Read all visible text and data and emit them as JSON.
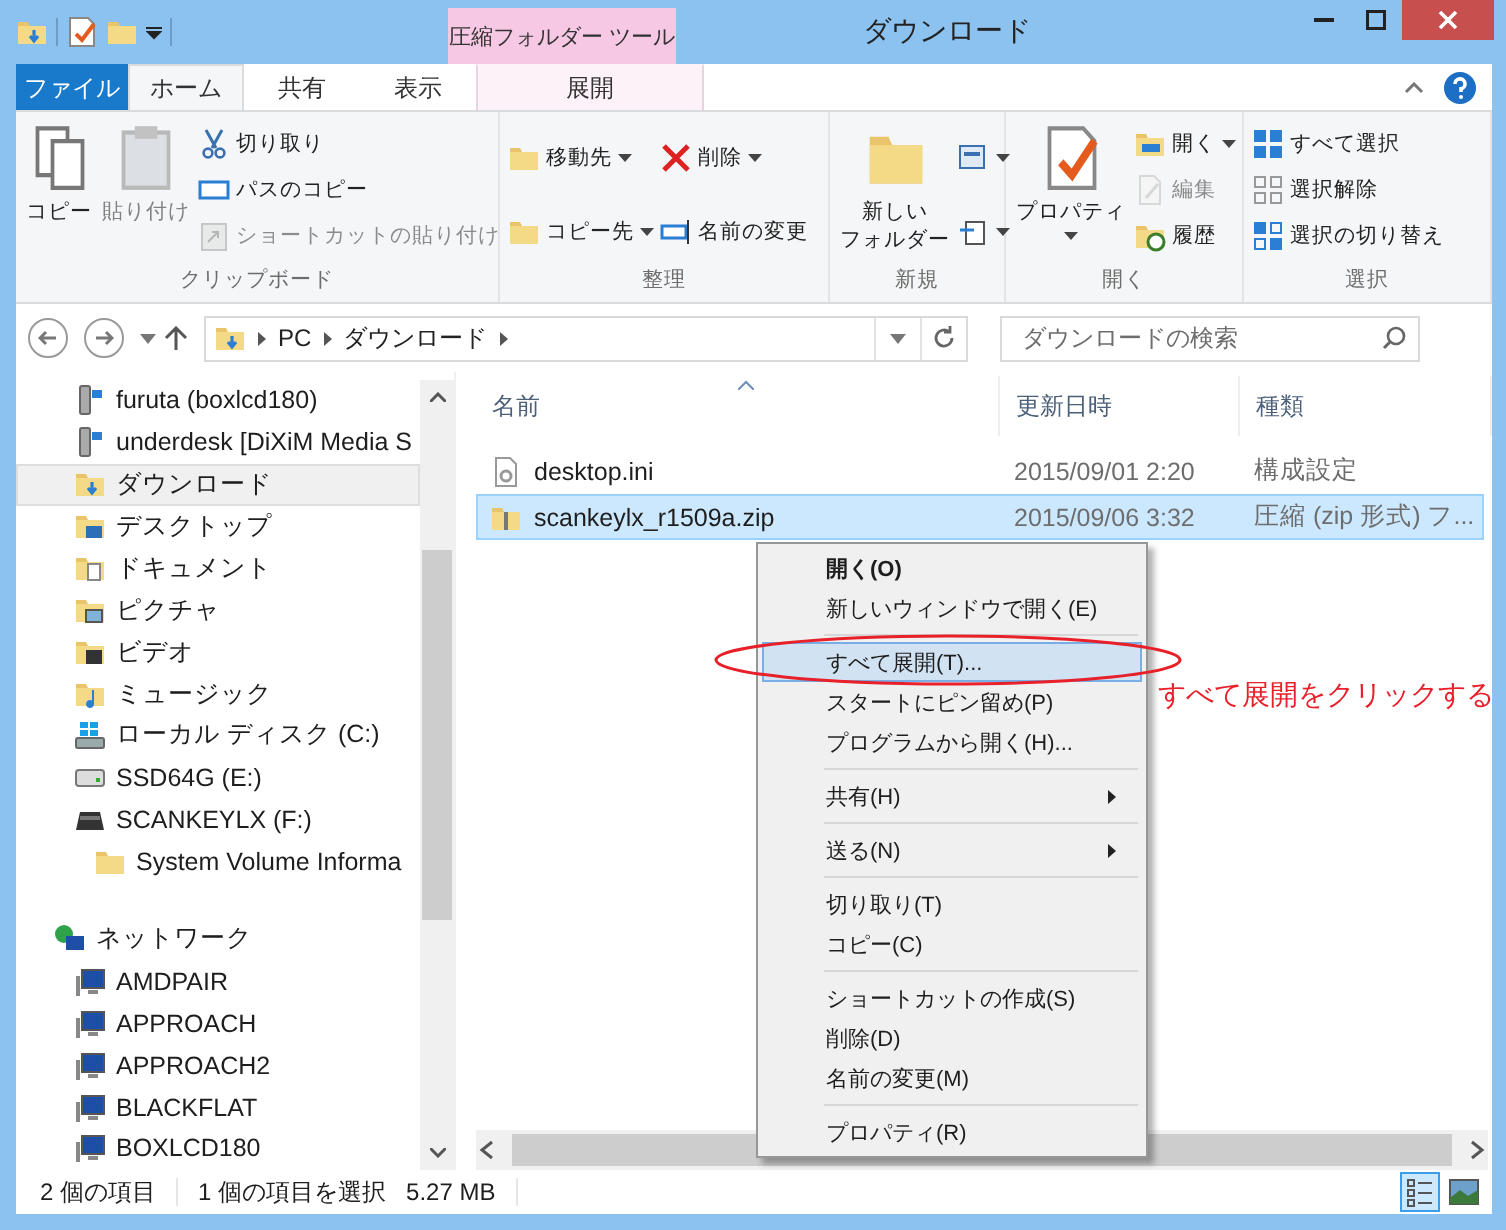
{
  "window": {
    "title": "ダウンロード"
  },
  "contextual_group": {
    "label": "圧縮フォルダー ツール"
  },
  "tabs": [
    {
      "label": "ファイル",
      "kind": "file",
      "selected": false
    },
    {
      "label": "ホーム",
      "kind": "normal",
      "selected": true
    },
    {
      "label": "共有",
      "kind": "normal",
      "selected": false
    },
    {
      "label": "表示",
      "kind": "normal",
      "selected": false
    },
    {
      "label": "展開",
      "kind": "contextual",
      "selected": false
    }
  ],
  "ribbon": [
    {
      "label": "クリップボード",
      "large": [
        {
          "lines": [
            "コピー"
          ],
          "kind": "copy",
          "disabled": false,
          "dropdown": false
        },
        {
          "lines": [
            "貼り付け"
          ],
          "kind": "paste",
          "disabled": true,
          "dropdown": false
        }
      ],
      "small_columns": [
        [
          {
            "label": "切り取り",
            "kind": "scissors",
            "disabled": false,
            "dropdown": false
          },
          {
            "label": "パスのコピー",
            "kind": "path",
            "disabled": false,
            "dropdown": false
          },
          {
            "label": "ショートカットの貼り付け",
            "kind": "shortcut",
            "disabled": true,
            "dropdown": false
          }
        ]
      ]
    },
    {
      "label": "整理",
      "small_columns": [
        [
          {
            "label": "移動先",
            "kind": "move",
            "disabled": false,
            "dropdown": true
          },
          {
            "label": "コピー先",
            "kind": "copyto",
            "disabled": false,
            "dropdown": true
          }
        ],
        [
          {
            "label": "削除",
            "kind": "delete",
            "disabled": false,
            "dropdown": true
          },
          {
            "label": "名前の変更",
            "kind": "rename",
            "disabled": false,
            "dropdown": false
          }
        ]
      ]
    },
    {
      "label": "新規",
      "large": [
        {
          "lines": [
            "新しい",
            "フォルダー"
          ],
          "kind": "folder",
          "disabled": false,
          "dropdown": false
        }
      ],
      "small_columns": [
        [
          {
            "kind": "newitem",
            "disabled": false,
            "dropdown": true
          },
          {
            "kind": "easyaccess",
            "disabled": false,
            "dropdown": true
          }
        ]
      ]
    },
    {
      "label": "開く",
      "large": [
        {
          "lines": [
            "プロパティ"
          ],
          "kind": "properties",
          "disabled": false,
          "dropdown": true
        }
      ],
      "small_columns": [
        [
          {
            "label": "開く",
            "kind": "open",
            "disabled": false,
            "dropdown": true
          },
          {
            "label": "編集",
            "kind": "edit",
            "disabled": true,
            "dropdown": false
          },
          {
            "label": "履歴",
            "kind": "history",
            "disabled": false,
            "dropdown": false
          }
        ]
      ]
    },
    {
      "label": "選択",
      "small_columns": [
        [
          {
            "label": "すべて選択",
            "kind": "selectall",
            "disabled": false,
            "dropdown": false
          },
          {
            "label": "選択解除",
            "kind": "selectnone",
            "disabled": false,
            "dropdown": false
          },
          {
            "label": "選択の切り替え",
            "kind": "invert",
            "disabled": false,
            "dropdown": false
          }
        ]
      ]
    }
  ],
  "address": {
    "path": [
      "PC",
      "ダウンロード"
    ]
  },
  "search": {
    "placeholder": "ダウンロードの検索"
  },
  "nav": {
    "items": [
      {
        "label": "furuta (boxlcd180)",
        "kind": "share",
        "selected": false
      },
      {
        "label": "underdesk [DiXiM Media S",
        "kind": "share",
        "selected": false
      },
      {
        "label": "ダウンロード",
        "kind": "downloads",
        "selected": true
      },
      {
        "label": "デスクトップ",
        "kind": "desktop",
        "selected": false
      },
      {
        "label": "ドキュメント",
        "kind": "documents",
        "selected": false
      },
      {
        "label": "ピクチャ",
        "kind": "pictures",
        "selected": false
      },
      {
        "label": "ビデオ",
        "kind": "videos",
        "selected": false
      },
      {
        "label": "ミュージック",
        "kind": "music",
        "selected": false
      },
      {
        "label": "ローカル ディスク (C:)",
        "kind": "system-drive",
        "selected": false
      },
      {
        "label": "SSD64G (E:)",
        "kind": "drive",
        "selected": false
      },
      {
        "label": "SCANKEYLX (F:)",
        "kind": "removable",
        "selected": false,
        "children": [
          {
            "label": "System Volume Informa",
            "kind": "folder",
            "selected": false
          }
        ]
      }
    ],
    "network": {
      "label": "ネットワーク",
      "children": [
        {
          "label": "AMDPAIR",
          "kind": "computer",
          "selected": false
        },
        {
          "label": "APPROACH",
          "kind": "computer",
          "selected": false
        },
        {
          "label": "APPROACH2",
          "kind": "computer",
          "selected": false
        },
        {
          "label": "BLACKFLAT",
          "kind": "computer",
          "selected": false
        },
        {
          "label": "BOXLCD180",
          "kind": "computer",
          "selected": false
        }
      ]
    }
  },
  "files": {
    "columns": [
      {
        "label": "名前",
        "sorted": true
      },
      {
        "label": "更新日時",
        "sorted": false
      },
      {
        "label": "種類",
        "sorted": false
      }
    ],
    "rows": [
      {
        "name": "desktop.ini",
        "date": "2015/09/01 2:20",
        "type": "構成設定",
        "kind": "settings",
        "selected": false
      },
      {
        "name": "scankeylx_r1509a.zip",
        "date": "2015/09/06 3:32",
        "type": "圧縮 (zip 形式) フ...",
        "kind": "zip",
        "selected": true
      }
    ]
  },
  "context_menu": [
    {
      "kind": "item",
      "label": "開く(O)",
      "default": true,
      "highlighted": false,
      "submenu": false
    },
    {
      "kind": "item",
      "label": "新しいウィンドウで開く(E)",
      "default": false,
      "highlighted": false,
      "submenu": false
    },
    {
      "kind": "separator"
    },
    {
      "kind": "item",
      "label": "すべて展開(T)...",
      "default": false,
      "highlighted": true,
      "submenu": false
    },
    {
      "kind": "item",
      "label": "スタートにピン留め(P)",
      "default": false,
      "highlighted": false,
      "submenu": false
    },
    {
      "kind": "item",
      "label": "プログラムから開く(H)...",
      "default": false,
      "highlighted": false,
      "submenu": false
    },
    {
      "kind": "separator"
    },
    {
      "kind": "item",
      "label": "共有(H)",
      "default": false,
      "highlighted": false,
      "submenu": true
    },
    {
      "kind": "separator"
    },
    {
      "kind": "item",
      "label": "送る(N)",
      "default": false,
      "highlighted": false,
      "submenu": true
    },
    {
      "kind": "separator"
    },
    {
      "kind": "item",
      "label": "切り取り(T)",
      "default": false,
      "highlighted": false,
      "submenu": false
    },
    {
      "kind": "item",
      "label": "コピー(C)",
      "default": false,
      "highlighted": false,
      "submenu": false
    },
    {
      "kind": "separator"
    },
    {
      "kind": "item",
      "label": "ショートカットの作成(S)",
      "default": false,
      "highlighted": false,
      "submenu": false
    },
    {
      "kind": "item",
      "label": "削除(D)",
      "default": false,
      "highlighted": false,
      "submenu": false
    },
    {
      "kind": "item",
      "label": "名前の変更(M)",
      "default": false,
      "highlighted": false,
      "submenu": false
    },
    {
      "kind": "separator"
    },
    {
      "kind": "item",
      "label": "プロパティ(R)",
      "default": false,
      "highlighted": false,
      "submenu": false
    }
  ],
  "annotation": {
    "text": "すべて展開をクリックする"
  },
  "status": {
    "item_count": "2 個の項目",
    "selection": "1 個の項目を選択",
    "size": "5.27 MB"
  },
  "views": [
    {
      "kind": "details",
      "selected": true
    },
    {
      "kind": "large-icons",
      "selected": false
    }
  ]
}
